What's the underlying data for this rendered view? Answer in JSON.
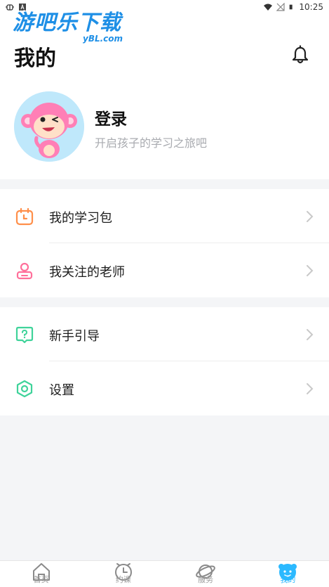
{
  "status_bar": {
    "time": "10:25"
  },
  "watermark": {
    "main": "游吧乐下载",
    "sub": "yBL.com"
  },
  "header": {
    "title": "我的",
    "login_title": "登录",
    "login_subtitle": "开启孩子的学习之旅吧"
  },
  "menu_group_1": [
    {
      "label": "我的学习包",
      "icon": "calendar-icon",
      "color": "#ff8f4a"
    },
    {
      "label": "我关注的老师",
      "icon": "teacher-icon",
      "color": "#ff6f9a"
    }
  ],
  "menu_group_2": [
    {
      "label": "新手引导",
      "icon": "help-icon",
      "color": "#3fd39a"
    },
    {
      "label": "设置",
      "icon": "settings-icon",
      "color": "#3fd39a"
    }
  ],
  "tabs": [
    {
      "label": "首页",
      "icon": "home-icon",
      "active": false
    },
    {
      "label": "约课",
      "icon": "clock-icon",
      "active": false
    },
    {
      "label": "服务",
      "icon": "planet-icon",
      "active": false
    },
    {
      "label": "我的",
      "icon": "profile-icon",
      "active": true
    }
  ],
  "colors": {
    "accent": "#2bb9ff",
    "background": "#f4f5f7"
  }
}
